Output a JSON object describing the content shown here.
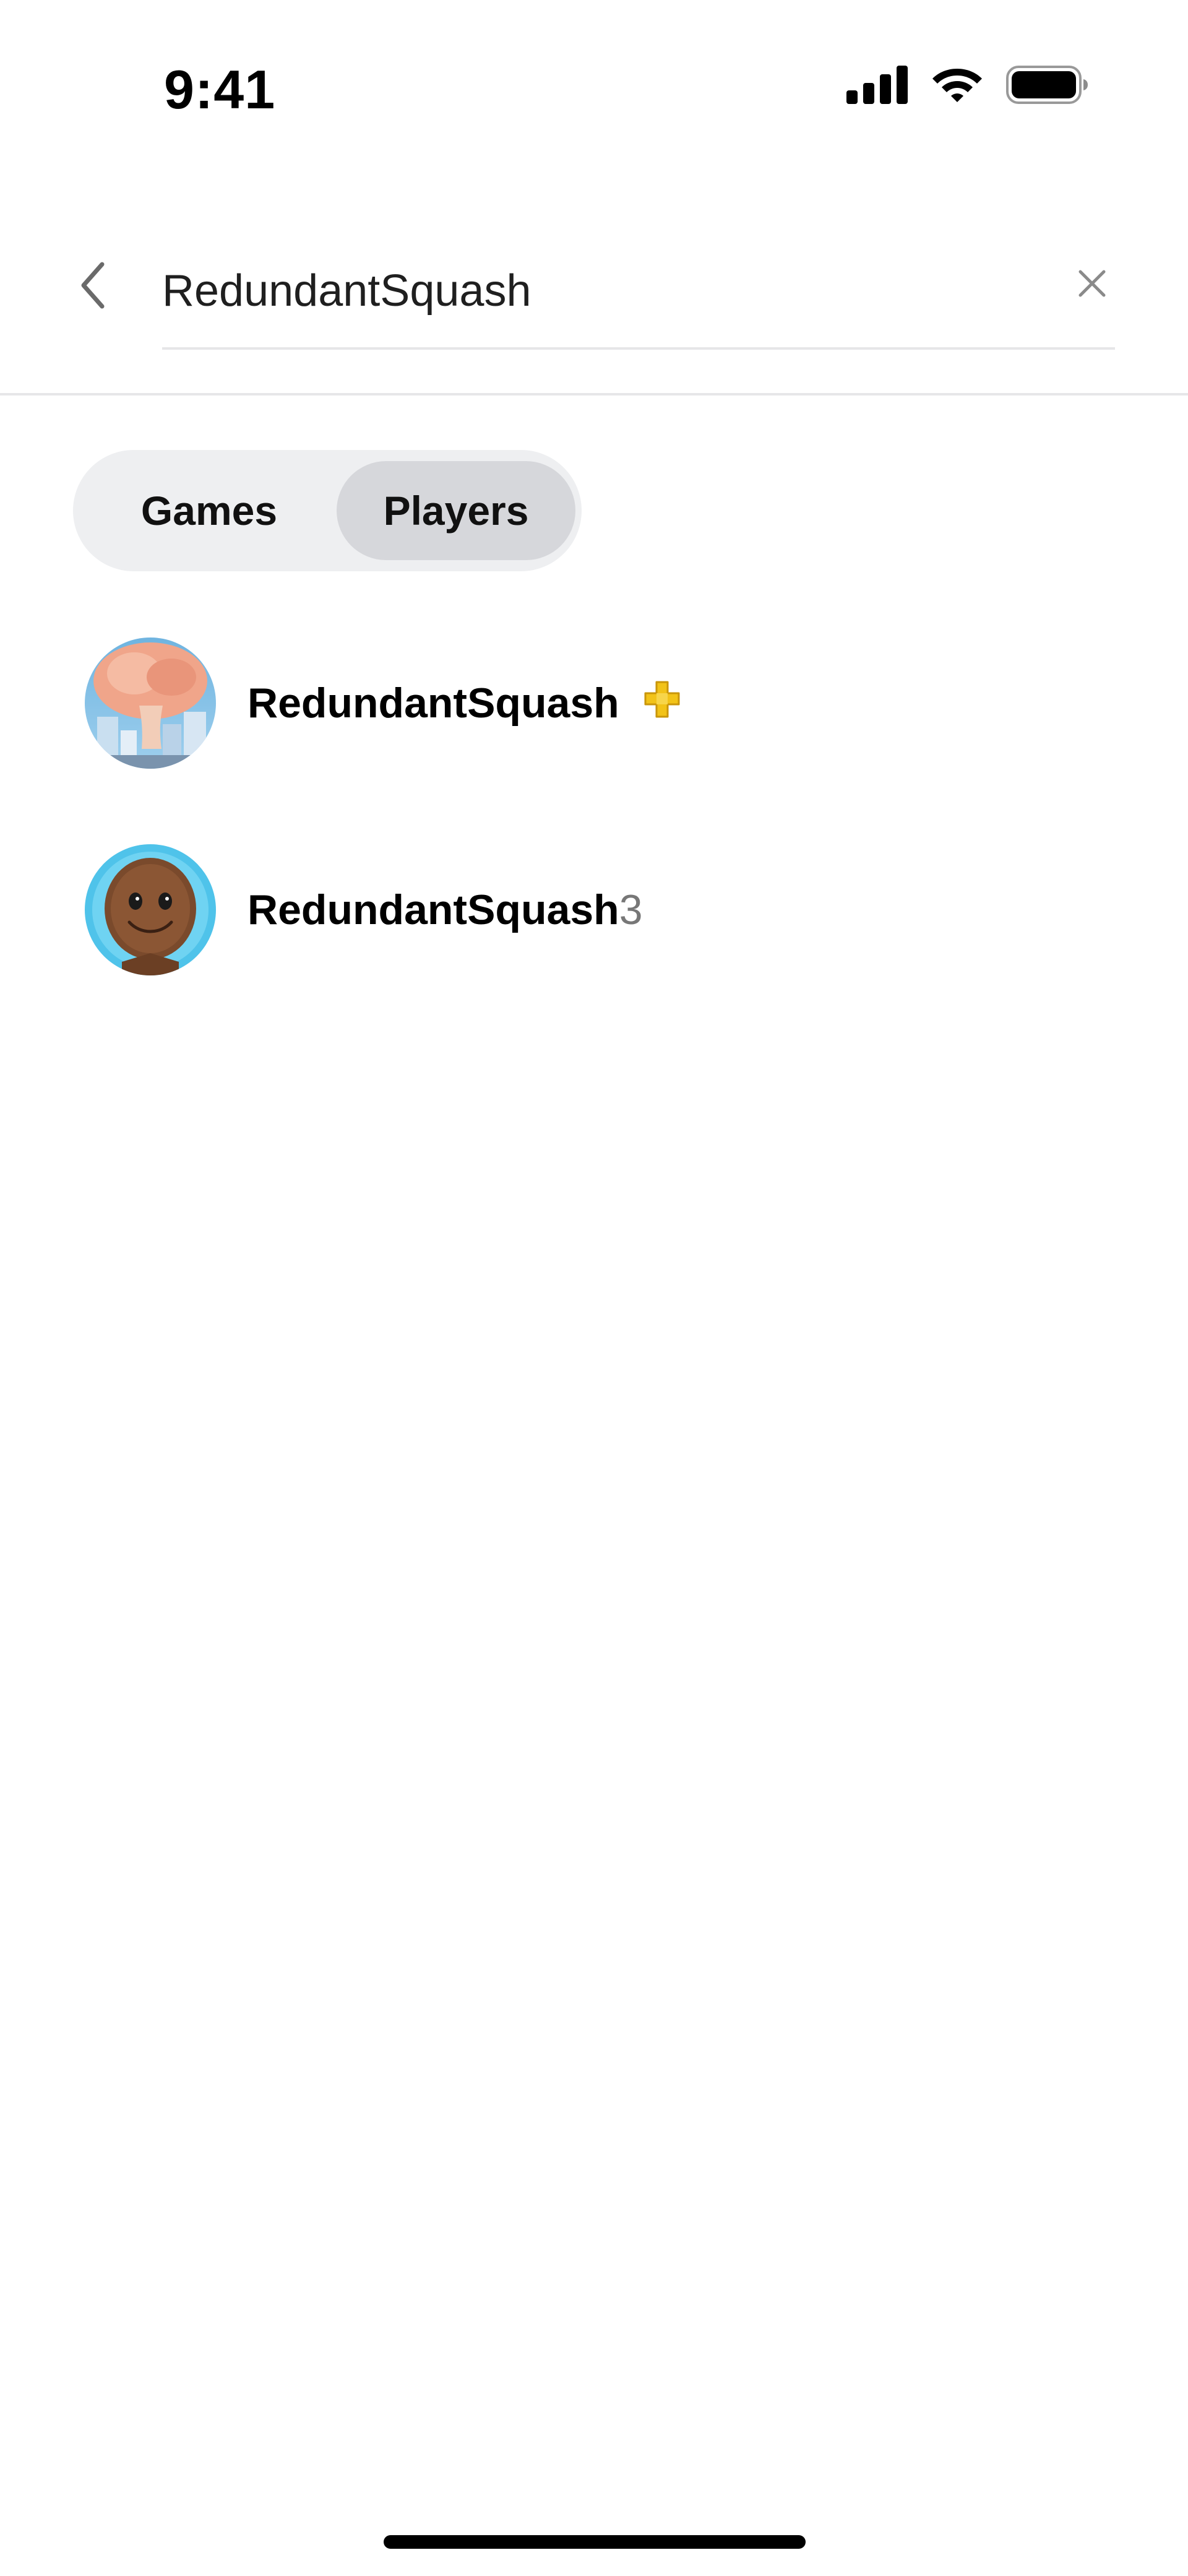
{
  "status_bar": {
    "time": "9:41"
  },
  "search": {
    "query": "RedundantSquash",
    "placeholder": ""
  },
  "tabs": [
    {
      "label": "Games",
      "selected": false
    },
    {
      "label": "Players",
      "selected": true
    }
  ],
  "results": [
    {
      "name_match": "RedundantSquash",
      "name_rest": "",
      "avatar_icon": "mushroom-cloud-avatar",
      "badge_icon": "playstation-plus-icon",
      "badge_color": "#f2c318"
    },
    {
      "name_match": "RedundantSquash",
      "name_rest": "3",
      "avatar_icon": "sackboy-avatar",
      "badge_icon": "",
      "badge_color": ""
    }
  ],
  "colors": {
    "selected_tab": "#d6d7db",
    "segment_bg": "#eeeff1",
    "divider": "#e6e6e8"
  }
}
